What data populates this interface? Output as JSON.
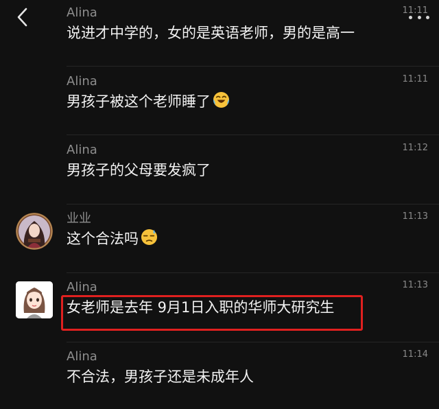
{
  "header": {
    "back_icon": "chevron-left-icon",
    "more_icon": "ellipsis-icon"
  },
  "messages": [
    {
      "sender": "Alina",
      "time": "11:11",
      "text": "说进才中学的，女的是英语老师，男的是高一"
    },
    {
      "sender": "Alina",
      "time": "11:11",
      "text": "男孩子被这个老师睡了",
      "emoji": "face-crying-laughing"
    },
    {
      "sender": "Alina",
      "time": "11:12",
      "text": "男孩子的父母要发疯了"
    },
    {
      "sender": "业业",
      "time": "11:13",
      "text": "这个合法吗",
      "emoji": "face-sweat"
    },
    {
      "sender": "Alina",
      "time": "11:13",
      "text": "女老师是去年 9月1日入职的华师大研究生",
      "highlighted": true
    },
    {
      "sender": "Alina",
      "time": "11:14",
      "text": "不合法，男孩子还是未成年人"
    }
  ],
  "colors": {
    "background": "#111111",
    "sender": "#8e8e8e",
    "text": "#f2f2f2",
    "highlight_border": "#e0201f"
  }
}
